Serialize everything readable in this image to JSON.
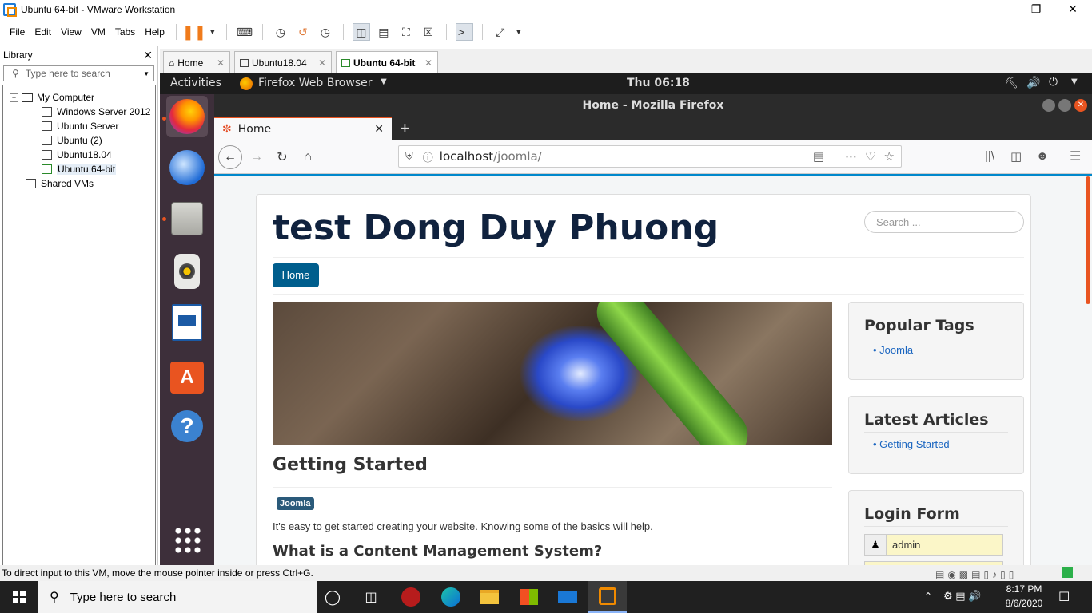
{
  "window": {
    "title": "Ubuntu 64-bit - VMware Workstation"
  },
  "menubar": {
    "items": [
      "File",
      "Edit",
      "View",
      "VM",
      "Tabs",
      "Help"
    ]
  },
  "library": {
    "title": "Library",
    "search_placeholder": "Type here to search",
    "tree": {
      "root": "My Computer",
      "vms": [
        "Windows Server 2012",
        "Ubuntu Server",
        "Ubuntu (2)",
        "Ubuntu18.04",
        "Ubuntu 64-bit"
      ],
      "shared": "Shared VMs"
    }
  },
  "vm_tabs": [
    {
      "label": "Home"
    },
    {
      "label": "Ubuntu18.04"
    },
    {
      "label": "Ubuntu 64-bit"
    }
  ],
  "ubuntu": {
    "activities": "Activities",
    "app_menu": "Firefox Web Browser",
    "clock": "Thu 06:18"
  },
  "firefox": {
    "window_title": "Home - Mozilla Firefox",
    "tab_title": "Home",
    "url_host": "localhost",
    "url_path": "/joomla/"
  },
  "site": {
    "title": "test Dong Duy Phuong",
    "search_placeholder": "Search ...",
    "nav_home": "Home",
    "article_title": "Getting Started",
    "tag": "Joomla",
    "intro": "It's easy to get started creating your website. Knowing some of the basics will help.",
    "subheading": "What is a Content Management System?",
    "sidebar": {
      "popular_tags_title": "Popular Tags",
      "popular_tags": [
        "Joomla"
      ],
      "latest_title": "Latest Articles",
      "latest": [
        "Getting Started"
      ],
      "login_title": "Login Form",
      "username_value": "admin"
    }
  },
  "statusbar": {
    "text": "To direct input to this VM, move the mouse pointer inside or press Ctrl+G."
  },
  "taskbar": {
    "search_placeholder": "Type here to search",
    "time": "8:17 PM",
    "date": "8/6/2020"
  }
}
